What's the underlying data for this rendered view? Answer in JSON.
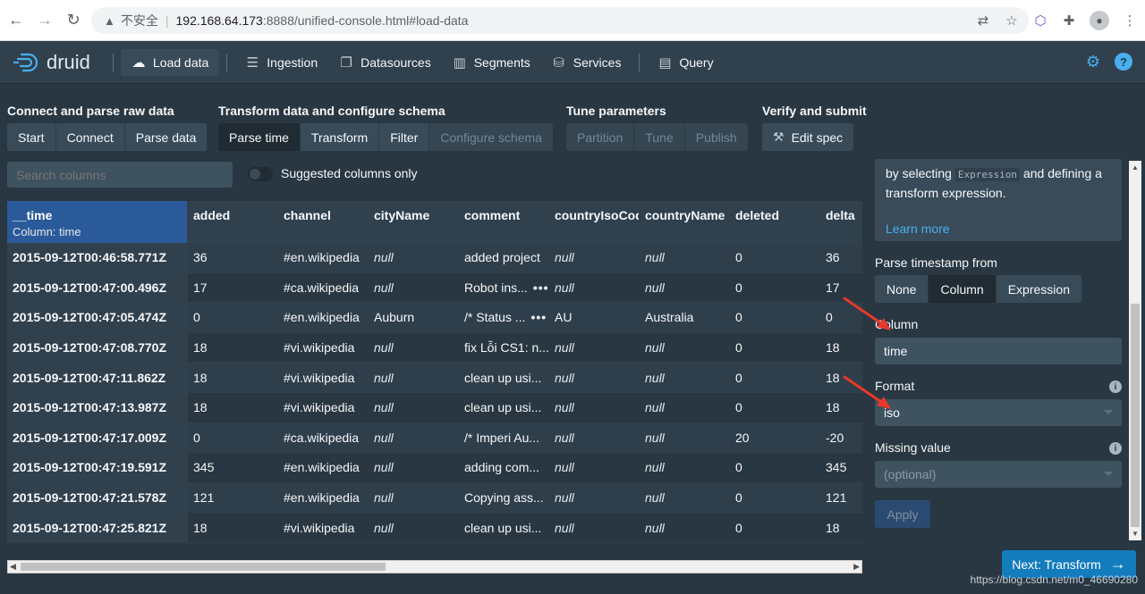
{
  "browser": {
    "insecure_label": "不安全",
    "url_host": "192.168.64.173",
    "url_path": ":8888/unified-console.html#load-data"
  },
  "header": {
    "logo_text": "druid",
    "nav": [
      {
        "label": "Load data",
        "icon": "cloud-upload-icon"
      },
      {
        "label": "Ingestion",
        "icon": "gantt-chart-icon"
      },
      {
        "label": "Datasources",
        "icon": "multi-select-icon"
      },
      {
        "label": "Segments",
        "icon": "stacked-chart-icon"
      },
      {
        "label": "Services",
        "icon": "database-icon"
      },
      {
        "label": "Query",
        "icon": "application-icon"
      }
    ]
  },
  "steps": [
    {
      "title": "Connect and parse raw data",
      "buttons": [
        "Start",
        "Connect",
        "Parse data"
      ]
    },
    {
      "title": "Transform data and configure schema",
      "buttons": [
        "Parse time",
        "Transform",
        "Filter",
        "Configure schema"
      ]
    },
    {
      "title": "Tune parameters",
      "buttons": [
        "Partition",
        "Tune",
        "Publish"
      ]
    },
    {
      "title": "Verify and submit",
      "buttons": [
        "Edit spec"
      ]
    }
  ],
  "search": {
    "placeholder": "Search columns"
  },
  "toggle_label": "Suggested columns only",
  "table": {
    "columns": [
      "__time",
      "added",
      "channel",
      "cityName",
      "comment",
      "countryIsoCod",
      "countryName",
      "deleted",
      "delta"
    ],
    "time_sub": "Column: time",
    "rows": [
      [
        "2015-09-12T00:46:58.771Z",
        "36",
        "#en.wikipedia",
        "null",
        "added project",
        "null",
        "null",
        "0",
        "36"
      ],
      [
        "2015-09-12T00:47:00.496Z",
        "17",
        "#ca.wikipedia",
        "null",
        "Robot ins...",
        "null",
        "null",
        "0",
        "17"
      ],
      [
        "2015-09-12T00:47:05.474Z",
        "0",
        "#en.wikipedia",
        "Auburn",
        "/* Status ...",
        "AU",
        "Australia",
        "0",
        "0"
      ],
      [
        "2015-09-12T00:47:08.770Z",
        "18",
        "#vi.wikipedia",
        "null",
        "fix Lỗi CS1: n...",
        "null",
        "null",
        "0",
        "18"
      ],
      [
        "2015-09-12T00:47:11.862Z",
        "18",
        "#vi.wikipedia",
        "null",
        "clean up usi...",
        "null",
        "null",
        "0",
        "18"
      ],
      [
        "2015-09-12T00:47:13.987Z",
        "18",
        "#vi.wikipedia",
        "null",
        "clean up usi...",
        "null",
        "null",
        "0",
        "18"
      ],
      [
        "2015-09-12T00:47:17.009Z",
        "0",
        "#ca.wikipedia",
        "null",
        "/* Imperi Au...",
        "null",
        "null",
        "20",
        "-20"
      ],
      [
        "2015-09-12T00:47:19.591Z",
        "345",
        "#en.wikipedia",
        "null",
        "adding com...",
        "null",
        "null",
        "0",
        "345"
      ],
      [
        "2015-09-12T00:47:21.578Z",
        "121",
        "#en.wikipedia",
        "null",
        "Copying ass...",
        "null",
        "null",
        "0",
        "121"
      ],
      [
        "2015-09-12T00:47:25.821Z",
        "18",
        "#vi.wikipedia",
        "null",
        "clean up usi...",
        "null",
        "null",
        "0",
        "18"
      ]
    ]
  },
  "panel": {
    "callout_pre": "by selecting",
    "callout_code": "Expression",
    "callout_post": "and defining a transform expression.",
    "learn_more": "Learn more",
    "parse_label": "Parse timestamp from",
    "parse_options": [
      "None",
      "Column",
      "Expression"
    ],
    "column_label": "Column",
    "column_value": "time",
    "format_label": "Format",
    "format_value": "iso",
    "missing_label": "Missing value",
    "missing_placeholder": "(optional)",
    "apply_label": "Apply"
  },
  "next_button": "Next: Transform",
  "watermark": "https://blog.csdn.net/m0_46690280",
  "colors": {
    "accent": "#137cbd",
    "annotation": "#e8382b"
  }
}
